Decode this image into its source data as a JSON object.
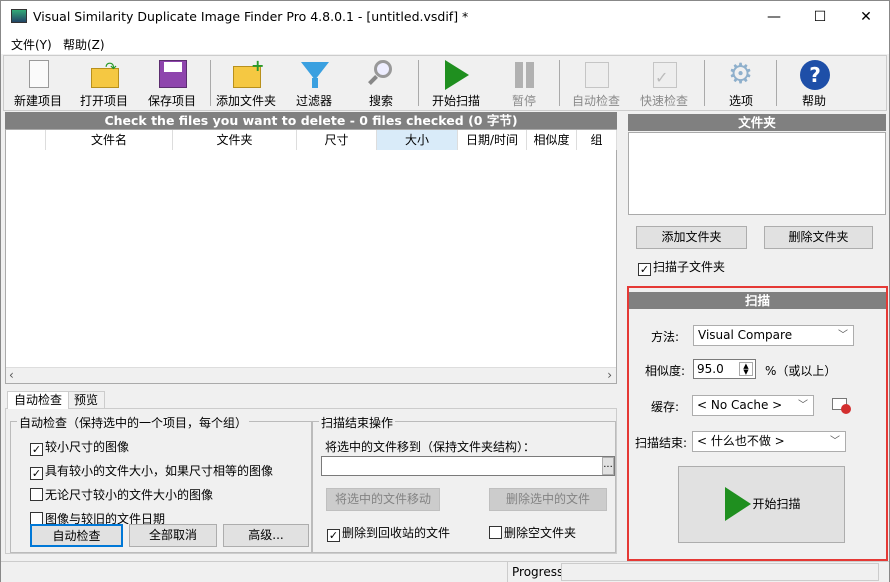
{
  "window": {
    "title": "Visual Similarity Duplicate Image Finder Pro 4.8.0.1 - [untitled.vsdif] *",
    "minimize": "—",
    "maximize": "☐",
    "close": "✕"
  },
  "menu": [
    "文件(Y)",
    "帮助(Z)"
  ],
  "toolbar": [
    {
      "label": "新建项目",
      "icon": "new-file-icon",
      "enabled": true
    },
    {
      "label": "打开项目",
      "icon": "open-folder-icon",
      "enabled": true
    },
    {
      "label": "保存项目",
      "icon": "floppy-disk-icon",
      "enabled": true
    },
    {
      "label": "添加文件夹",
      "icon": "add-folder-icon",
      "enabled": true
    },
    {
      "label": "过滤器",
      "icon": "funnel-icon",
      "enabled": true
    },
    {
      "label": "搜索",
      "icon": "magnifier-icon",
      "enabled": true
    },
    {
      "label": "开始扫描",
      "icon": "play-icon",
      "enabled": true
    },
    {
      "label": "暂停",
      "icon": "pause-icon",
      "enabled": false
    },
    {
      "label": "自动检查",
      "icon": "auto-check-icon",
      "enabled": false
    },
    {
      "label": "快速检查",
      "icon": "quick-check-icon",
      "enabled": false
    },
    {
      "label": "选项",
      "icon": "gear-icon",
      "enabled": true
    },
    {
      "label": "帮助",
      "icon": "help-icon",
      "enabled": true
    }
  ],
  "list": {
    "banner": "Check the files you want to delete - 0 files checked (0 字节)",
    "columns": [
      "",
      "文件名",
      "文件夹",
      "尺寸",
      "大小",
      "日期/时间",
      "相似度",
      "组"
    ]
  },
  "tabs": [
    "自动检查",
    "预览"
  ],
  "autocheck": {
    "title": "自动检查（保持选中的一个项目，每个组）",
    "options": [
      {
        "label": "较小尺寸的图像",
        "checked": true
      },
      {
        "label": "具有较小的文件大小，如果尺寸相等的图像",
        "checked": true
      },
      {
        "label": "无论尺寸较小的文件大小的图像",
        "checked": false
      },
      {
        "label": "图像与较旧的文件日期",
        "checked": false
      }
    ],
    "buttons": [
      "自动检查",
      "全部取消",
      "高级..."
    ]
  },
  "scan_end": {
    "title": "扫描结束操作",
    "move_label": "将选中的文件移到（保持文件夹结构）：",
    "move_path": "",
    "browse": "...",
    "move_button": "将选中的文件移动",
    "delete_button": "删除选中的文件",
    "recycle": {
      "label": "删除到回收站的文件",
      "checked": true
    },
    "delete_empty": {
      "label": "删除空文件夹",
      "checked": false
    }
  },
  "folders": {
    "title": "文件夹",
    "add": "添加文件夹",
    "remove": "删除文件夹",
    "subfolders": {
      "label": "扫描子文件夹",
      "checked": true
    }
  },
  "scan": {
    "title": "扫描",
    "method_label": "方法:",
    "method": "Visual Compare",
    "similarity_label": "相似度:",
    "similarity": "95.0",
    "similarity_suffix": "%（或以上）",
    "cache_label": "缓存:",
    "cache": "< No Cache >",
    "end_label": "扫描结束:",
    "end": "< 什么也不做 >",
    "start": "开始扫描",
    "highlight_color": "#e53935"
  },
  "status": {
    "progress_label": "Progress"
  }
}
